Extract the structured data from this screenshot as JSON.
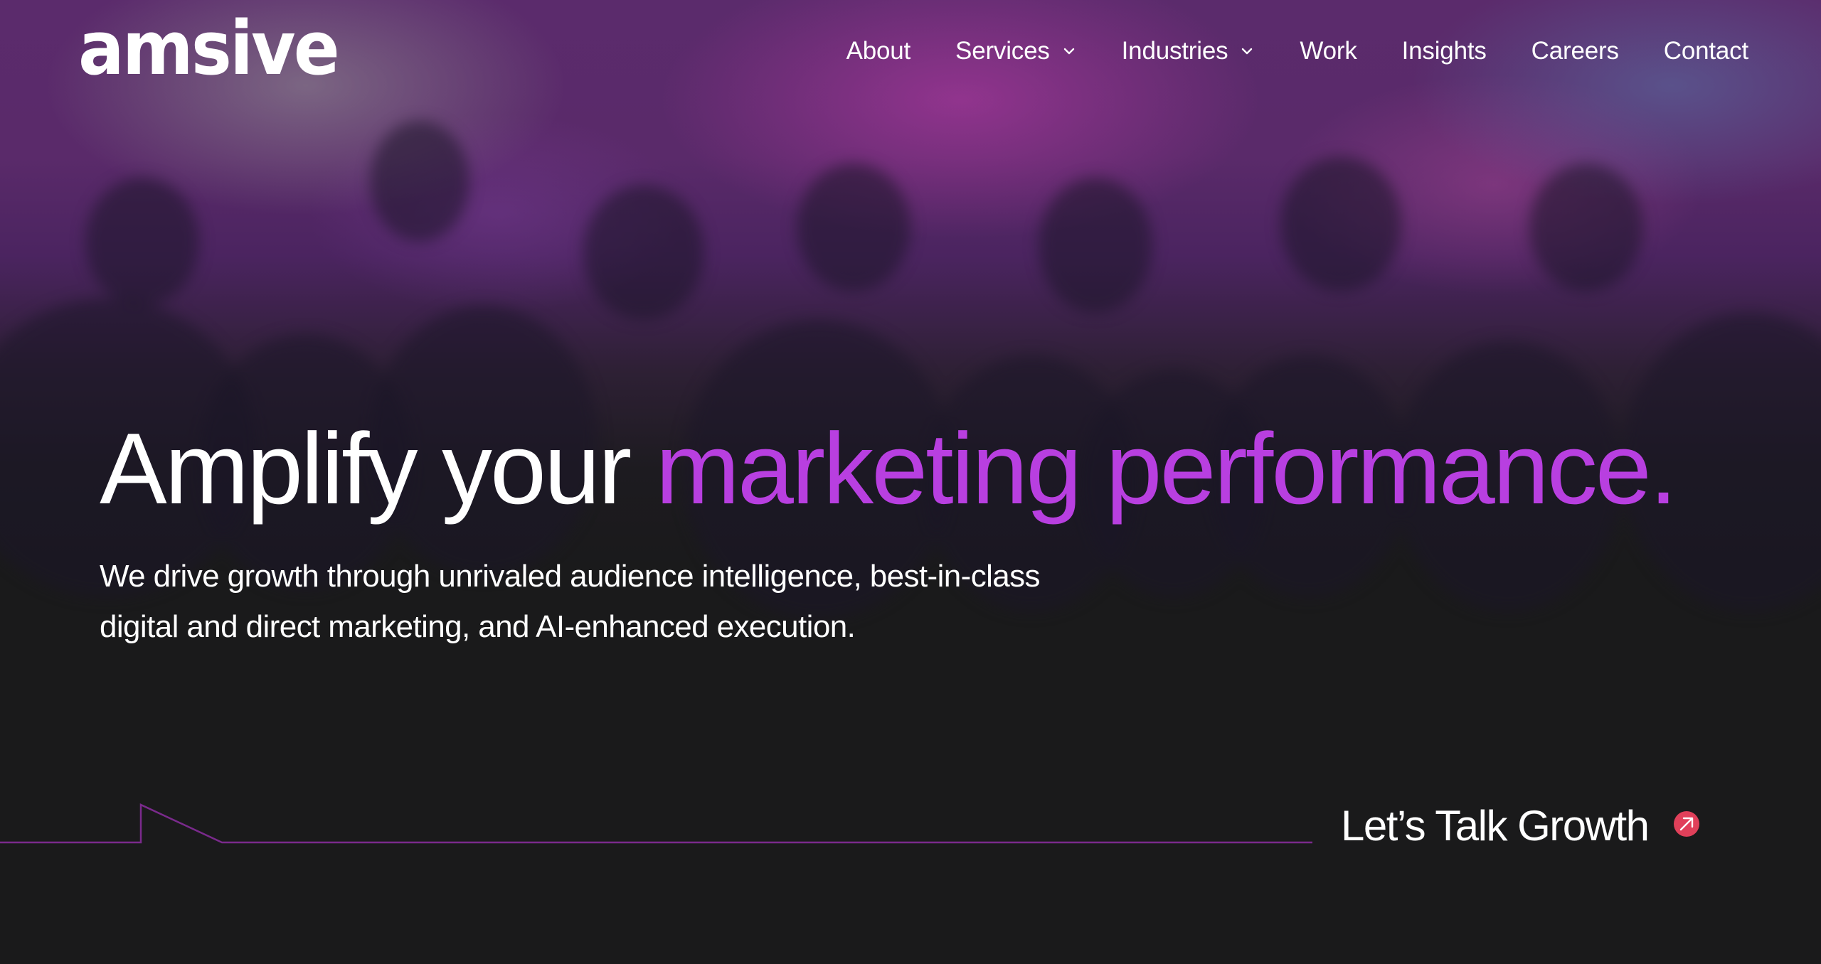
{
  "brand": {
    "logo_text": "amsive",
    "accent_color": "#b83fe0",
    "cta_icon_color": "#e0405a"
  },
  "nav": {
    "items": [
      {
        "label": "About",
        "has_dropdown": false
      },
      {
        "label": "Services",
        "has_dropdown": true
      },
      {
        "label": "Industries",
        "has_dropdown": true
      },
      {
        "label": "Work",
        "has_dropdown": false
      },
      {
        "label": "Insights",
        "has_dropdown": false
      },
      {
        "label": "Careers",
        "has_dropdown": false
      },
      {
        "label": "Contact",
        "has_dropdown": false
      }
    ]
  },
  "hero": {
    "headline_plain": "Amplify your ",
    "headline_accent": "marketing performance.",
    "subhead_line1": "We drive growth through unrivaled audience intelligence, best-in-class",
    "subhead_line2": "digital and direct marketing, and AI-enhanced execution."
  },
  "cta": {
    "label": "Let’s Talk Growth",
    "icon": "arrow-up-right-circle-icon"
  }
}
